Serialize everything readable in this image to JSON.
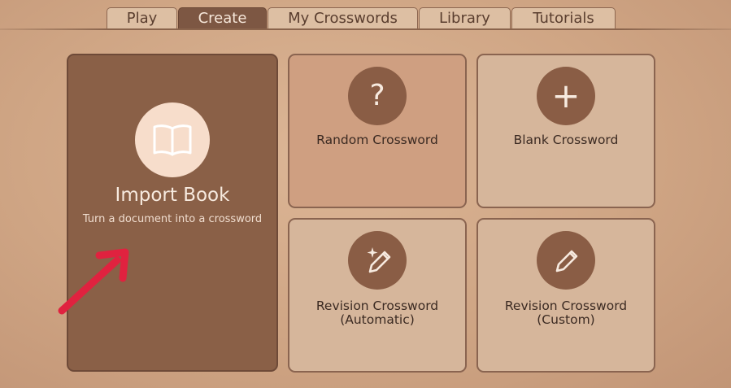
{
  "tabs": [
    {
      "label": "Play",
      "active": false
    },
    {
      "label": "Create",
      "active": true
    },
    {
      "label": "My Crosswords",
      "active": false
    },
    {
      "label": "Library",
      "active": false
    },
    {
      "label": "Tutorials",
      "active": false
    }
  ],
  "import_book": {
    "title": "Import Book",
    "subtitle": "Turn a document into a crossword",
    "icon": "book-icon"
  },
  "options": {
    "random": {
      "label": "Random Crossword",
      "icon": "question-mark-icon",
      "glyph": "?"
    },
    "blank": {
      "label": "Blank Crossword",
      "icon": "plus-icon",
      "glyph": "+"
    },
    "revision_auto": {
      "label": "Revision Crossword\n(Automatic)",
      "icon": "magic-pencil-icon"
    },
    "revision_custom": {
      "label": "Revision Crossword\n(Custom)",
      "icon": "pencil-icon"
    }
  },
  "annotation": {
    "icon": "red-arrow-icon",
    "color": "#e0223f"
  },
  "colors": {
    "background": "#d4ab8b",
    "active_tab": "#7d5743",
    "import_card": "#8a6047",
    "random_card": "#cf9f81",
    "card": "#d6b69b",
    "icon_circle": "#8a5d45"
  }
}
